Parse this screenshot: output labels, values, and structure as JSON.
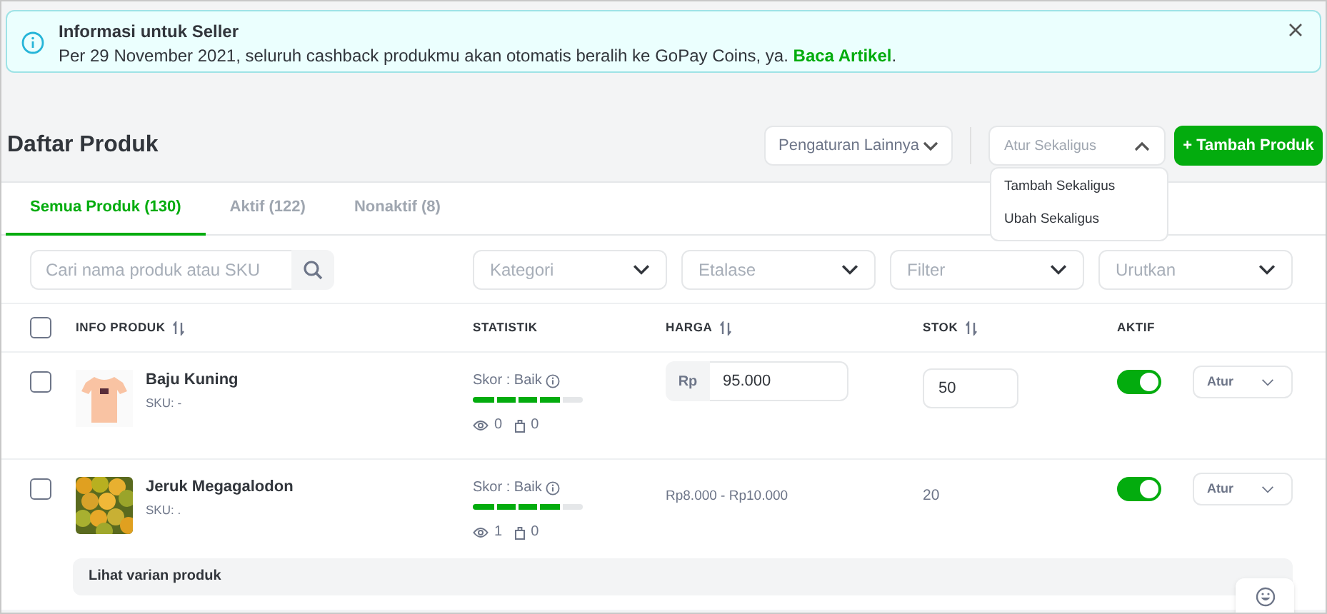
{
  "banner": {
    "title": "Informasi untuk Seller",
    "text": "Per 29 November 2021, seluruh cashback produkmu akan otomatis beralih ke GoPay Coins, ya.",
    "link": "Baca Artikel",
    "link_end": "."
  },
  "page_title": "Daftar Produk",
  "actions": {
    "more_settings": "Pengaturan Lainnya",
    "bulk": {
      "placeholder": "Atur Sekaligus",
      "expanded": true,
      "options": [
        "Tambah Sekaligus",
        "Ubah Sekaligus"
      ]
    },
    "add": "+ Tambah Produk"
  },
  "tabs": [
    {
      "label": "Semua Produk (130)",
      "selected": true
    },
    {
      "label": "Aktif (122)",
      "selected": false
    },
    {
      "label": "Nonaktif (8)",
      "selected": false
    }
  ],
  "search": {
    "placeholder": "Cari nama produk atau SKU"
  },
  "filters": [
    "Kategori",
    "Etalase",
    "Filter",
    "Urutkan"
  ],
  "table": {
    "select_all": false,
    "columns": [
      {
        "label": "INFO PRODUK",
        "sortable": true
      },
      {
        "label": "STATISTIK",
        "sortable": false
      },
      {
        "label": "HARGA",
        "sortable": true
      },
      {
        "label": "STOK",
        "sortable": true
      },
      {
        "label": "AKTIF",
        "sortable": false
      }
    ],
    "rows": [
      {
        "kind": "single",
        "checked": false,
        "name": "Baju Kuning",
        "sku": "SKU: -",
        "score": "Skor : Baik",
        "level": 0.8,
        "views": "0",
        "sold": "0",
        "price_prefix": "Rp",
        "price": "95.000",
        "stock": "50",
        "active": true,
        "action": "Atur"
      },
      {
        "kind": "variant",
        "checked": false,
        "name": "Jeruk Megagalodon",
        "sku": "SKU: .",
        "score": "Skor : Baik",
        "level": 0.8,
        "views": "1",
        "sold": "0",
        "price": "Rp8.000 - Rp10.000",
        "stock": "20",
        "active": true,
        "action": "Atur",
        "variant_link": "Lihat varian produk"
      }
    ]
  }
}
